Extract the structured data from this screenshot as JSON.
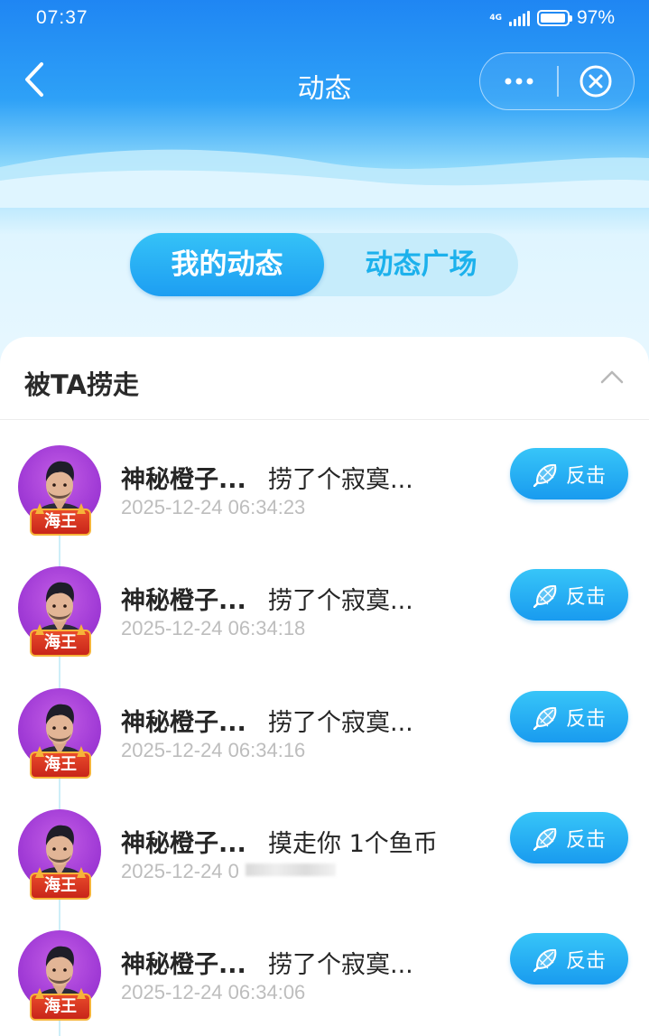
{
  "status_bar": {
    "time": "07:37",
    "network": "4G",
    "battery_percent": 97,
    "battery_text": "97%"
  },
  "nav": {
    "title": "动态",
    "back_icon": "chevron-left-icon",
    "more_icon": "more-dots-icon",
    "close_icon": "close-circle-icon"
  },
  "tabs": [
    {
      "label": "我的动态",
      "active": true
    },
    {
      "label": "动态广场",
      "active": false
    }
  ],
  "section": {
    "title": "被TA捞走",
    "expanded": true
  },
  "items": [
    {
      "name": "神秘橙子...",
      "action": "捞了个寂寞...",
      "time": "2025-12-24 06:34:23",
      "badge": "海王",
      "button": "反击"
    },
    {
      "name": "神秘橙子...",
      "action": "捞了个寂寞...",
      "time": "2025-12-24 06:34:18",
      "badge": "海王",
      "button": "反击"
    },
    {
      "name": "神秘橙子...",
      "action": "捞了个寂寞...",
      "time": "2025-12-24 06:34:16",
      "badge": "海王",
      "button": "反击"
    },
    {
      "name": "神秘橙子...",
      "action": "摸走你 1个鱼币",
      "time": "2025-12-24 0",
      "badge": "海王",
      "button": "反击",
      "time_obscured": true
    },
    {
      "name": "神秘橙子...",
      "action": "捞了个寂寞...",
      "time": "2025-12-24 06:34:06",
      "badge": "海王",
      "button": "反击"
    }
  ],
  "colors": {
    "primary": "#1d9ef2",
    "badge_red": "#d8311e",
    "avatar_purple": "#a13bd6"
  }
}
